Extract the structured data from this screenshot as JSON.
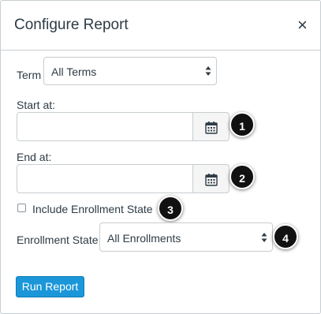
{
  "dialog": {
    "title": "Configure Report",
    "close_glyph": "×"
  },
  "form": {
    "term": {
      "label": "Term",
      "value": "All Terms"
    },
    "start_at": {
      "label": "Start at:",
      "value": "",
      "callout": "1"
    },
    "end_at": {
      "label": "End at:",
      "value": "",
      "callout": "2"
    },
    "include_enrollment_state": {
      "label": "Include Enrollment State",
      "checked": false,
      "callout": "3"
    },
    "enrollment_state": {
      "label": "Enrollment State",
      "value": "All Enrollments",
      "callout": "4"
    },
    "run_label": "Run Report"
  },
  "icons": {
    "close": "close-icon",
    "calendar": "calendar-icon",
    "select_arrows": "chevron-up-down-icon"
  },
  "colors": {
    "primary_button": "#1b97d9",
    "text": "#2d3b45",
    "border": "#c7cdd1",
    "callout": "#111111"
  }
}
